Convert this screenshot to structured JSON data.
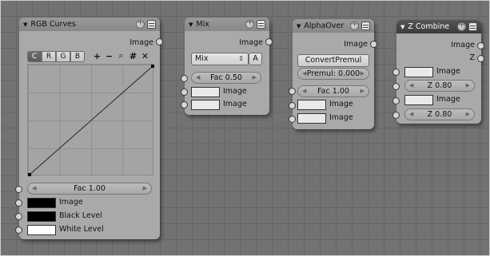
{
  "nodes": {
    "rgb_curves": {
      "title": "RGB Curves",
      "output": "Image",
      "tabs": [
        "C",
        "R",
        "G",
        "B"
      ],
      "fac": "Fac 1.00",
      "inputs": [
        "Image",
        "Black Level",
        "White Level"
      ],
      "swatch_colors": [
        "#000000",
        "#000000",
        "#ffffff"
      ]
    },
    "mix": {
      "title": "Mix",
      "output": "Image",
      "blend_mode": "Mix",
      "alpha_button": "A",
      "fac": "Fac 0.50",
      "inputs": [
        "Image",
        "Image"
      ]
    },
    "alpha_over": {
      "title": "AlphaOver",
      "output": "Image",
      "convert_button": "ConvertPremul",
      "premul": "Premul: 0.000",
      "fac": "Fac 1.00",
      "inputs": [
        "Image",
        "Image"
      ]
    },
    "z_combine": {
      "title": "Z Combine",
      "outputs": [
        "Image",
        "Z"
      ],
      "inputs": [
        "Image",
        "Image"
      ],
      "z_values": [
        "Z 0.80",
        "Z 0.80"
      ]
    }
  },
  "icons": [
    "collapse-triangle-icon",
    "add-icon",
    "remove-icon",
    "zoom-icon",
    "grid-icon",
    "close-icon",
    "node-options-icon",
    "node-menu-icon"
  ]
}
